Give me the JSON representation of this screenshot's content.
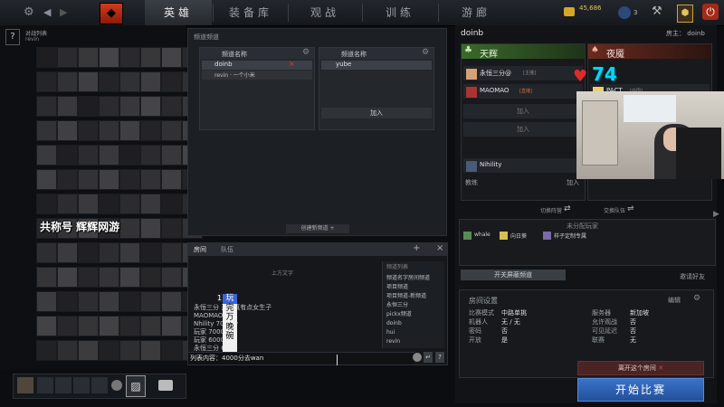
{
  "topbar": {
    "tabs": [
      "英雄",
      "装备库",
      "观战",
      "训练",
      "游廊"
    ],
    "gold": "45,686",
    "level_badge": "3"
  },
  "left": {
    "watermark": "共称号 辉辉网游",
    "overlay_title": "对战列表",
    "overlay_sub": "revin",
    "help_mark": "?"
  },
  "channels": {
    "panel_title": "频道频道",
    "col1_header": "频道名称",
    "col1_items": [
      "doinb",
      "revin · 一个小米"
    ],
    "col2_header": "频道名称",
    "col2_items": [
      "yube"
    ],
    "join_label": "加入",
    "create_label": "创建新频道",
    "create_plus": "+"
  },
  "chat": {
    "tabs": [
      "房间",
      "队伍"
    ],
    "center_tag": "上方文字",
    "lines": [
      "永恒三分  开局真有点女生子",
      "MAOMAO  ...",
      "Nhility  7000分",
      "玩家  7000分",
      "玩家  6000分",
      "永恒三分  6000",
      "疯狂  v4000"
    ],
    "overlay_chars": [
      "1",
      "玩",
      "完",
      "万",
      "晚",
      "碗"
    ],
    "input_text": "列表内容：4000分去wan",
    "channel_list_title": "频道列表",
    "channel_list": [
      "频道名字房间频道",
      "项目频道",
      "项目频道-新频道",
      "永恒三分",
      "pickx频道",
      "doinb",
      "hui",
      "revin",
      "who"
    ]
  },
  "lobby": {
    "host_name": "doinb",
    "host_label": "房主： doinb",
    "radiant_title": "天辉",
    "dire_title": "夜魇",
    "radiant_players": [
      {
        "name": "永恒三分@",
        "tag": "[主播]"
      },
      {
        "name": "MAOMAO",
        "tag": "[直播]"
      }
    ],
    "radiant_join": [
      "加入",
      "加入"
    ],
    "dire_players": [
      {
        "name": "PACT",
        "tag": "[中国]"
      }
    ],
    "coach_player": "Nihility",
    "coach_label": "教练",
    "coach_join": "加入",
    "radiant_switch": "切换阵营",
    "dire_switch": "交换队伍",
    "unassigned_title": "未分配玩家",
    "unassigned": [
      "whale",
      "向日葵",
      "样子定制专属"
    ],
    "bot_button": "开关屏蔽频道",
    "invite_label": "邀请好友",
    "settings_title": "房间设置",
    "edit_label": "编辑",
    "settings_left": [
      {
        "label": "比赛模式",
        "value": "中路单挑"
      },
      {
        "label": "机器人",
        "value": "无 / 无"
      },
      {
        "label": "密码",
        "value": "否"
      },
      {
        "label": "开放",
        "value": "是"
      }
    ],
    "settings_right": [
      {
        "label": "服务器",
        "value": "新加坡"
      },
      {
        "label": "允许观战",
        "value": "否"
      },
      {
        "label": "可见延迟",
        "value": "否"
      },
      {
        "label": "联赛",
        "value": "无"
      }
    ],
    "leave_button": "离开这个房间",
    "start_button": "开始比赛"
  },
  "webcam": {
    "counter": "74"
  },
  "colors": {
    "accent": "#c8a44a",
    "start_btn": "#2f5fa8",
    "leave_btn": "#5a2a2a",
    "heart": "#e02a2a",
    "counter": "#00d8ff"
  }
}
